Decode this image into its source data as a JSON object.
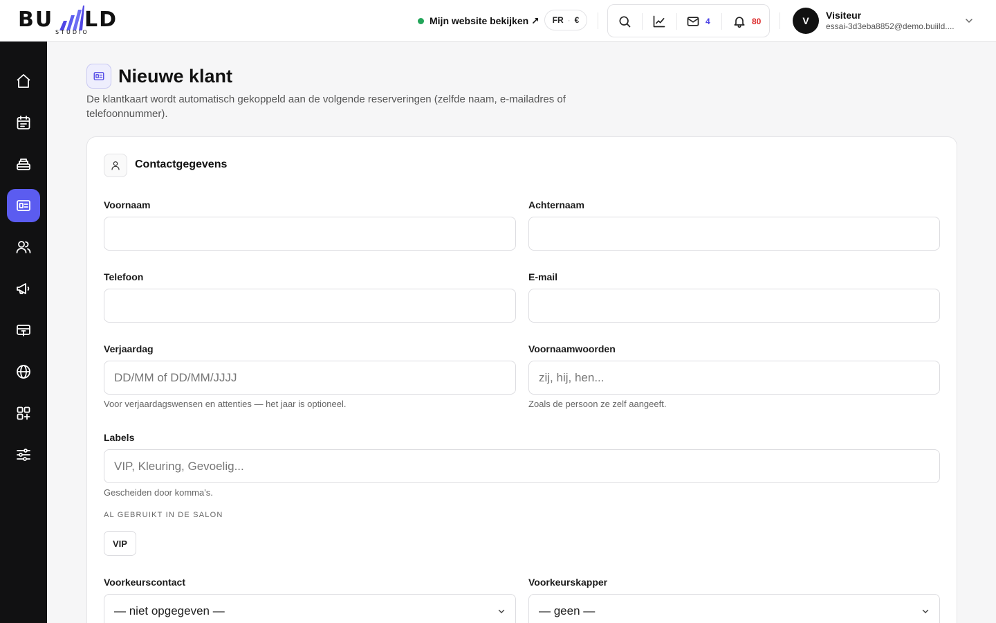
{
  "header": {
    "logo_text_left": "BU",
    "logo_text_right": "LD",
    "logo_subtitle": "STUDIO",
    "site_link_label": "Mijn website bekijken ↗",
    "language": "FR",
    "currency": "€",
    "mail_count": "4",
    "notification_count": "80",
    "user_initial": "V",
    "user_name": "Visiteur",
    "user_email": "essai-3d3eba8852@demo.buiild...."
  },
  "sidebar": {
    "items": [
      {
        "icon": "home-icon"
      },
      {
        "icon": "calendar-icon"
      },
      {
        "icon": "register-icon"
      },
      {
        "icon": "client-card-icon",
        "active": true
      },
      {
        "icon": "users-icon"
      },
      {
        "icon": "megaphone-icon"
      },
      {
        "icon": "cash-icon"
      },
      {
        "icon": "globe-icon"
      },
      {
        "icon": "apps-icon"
      },
      {
        "icon": "settings-sliders-icon"
      }
    ]
  },
  "page": {
    "title": "Nieuwe klant",
    "description": "De klantkaart wordt automatisch gekoppeld aan de volgende reserveringen (zelfde naam, e-mailadres of telefoonnummer)."
  },
  "contact": {
    "section_title": "Contactgegevens",
    "first_name": {
      "label": "Voornaam",
      "value": "",
      "placeholder": ""
    },
    "last_name": {
      "label": "Achternaam",
      "value": "",
      "placeholder": ""
    },
    "phone": {
      "label": "Telefoon",
      "value": "",
      "placeholder": ""
    },
    "email": {
      "label": "E-mail",
      "value": "",
      "placeholder": ""
    },
    "birthday": {
      "label": "Verjaardag",
      "placeholder": "DD/MM of DD/MM/JJJJ",
      "hint": "Voor verjaardagswensen en attenties — het jaar is optioneel."
    },
    "pronouns": {
      "label": "Voornaamwoorden",
      "placeholder": "zij, hij, hen...",
      "hint": "Zoals de persoon ze zelf aangeeft."
    },
    "labels": {
      "label": "Labels",
      "placeholder": "VIP, Kleuring, Gevoelig...",
      "hint": "Gescheiden door komma's.",
      "used_caption": "AL GEBRUIKT IN DE SALON",
      "used_tags": [
        "VIP"
      ]
    },
    "preferred_contact": {
      "label": "Voorkeurscontact",
      "selected": "— niet opgegeven —"
    },
    "preferred_stylist": {
      "label": "Voorkeurskapper",
      "selected": "— geen —"
    }
  },
  "colors": {
    "accent": "#5b5cf0",
    "sidebar_bg": "#111112",
    "online_dot": "#22a559",
    "mail_count": "#4f46e5",
    "notification_count": "#dc2626"
  }
}
